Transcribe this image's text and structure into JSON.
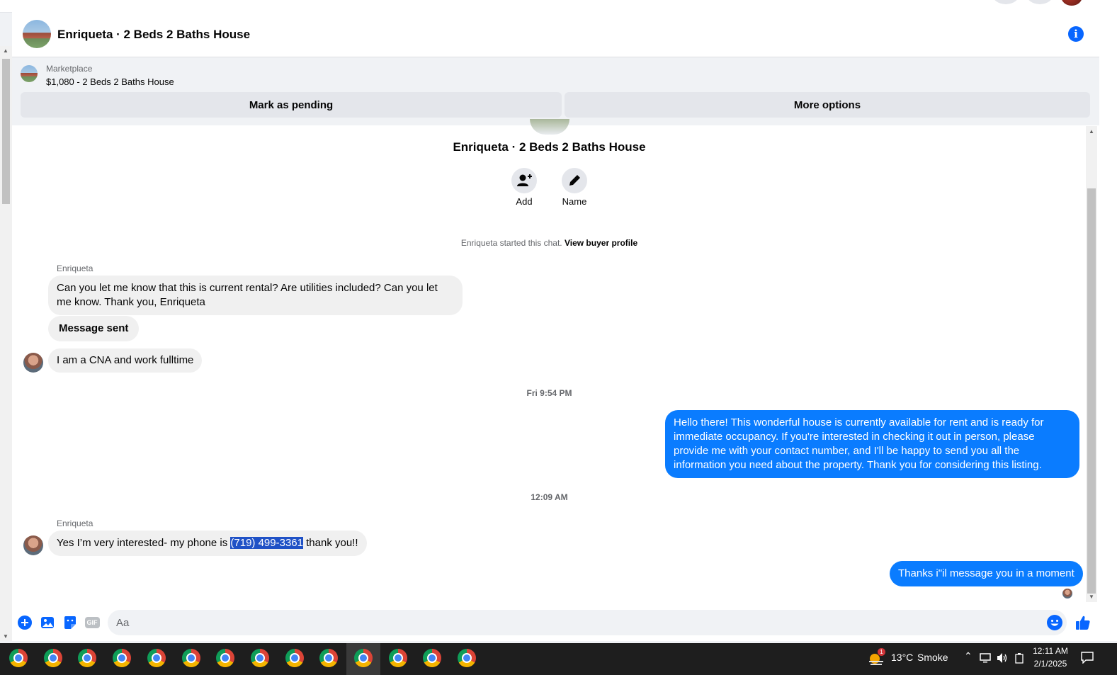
{
  "header": {
    "title": "Enriqueta · 2 Beds 2 Baths House"
  },
  "marketplace": {
    "label": "Marketplace",
    "listing": "$1,080 - 2 Beds 2 Baths House",
    "mark_pending": "Mark as pending",
    "more_options": "More options"
  },
  "conversation": {
    "title": "Enriqueta · 2 Beds 2 Baths House",
    "add_label": "Add",
    "name_label": "Name",
    "started_text": "Enriqueta started this chat.",
    "view_profile": "View buyer profile"
  },
  "messages": {
    "sender1": "Enriqueta",
    "msg1": "Can you let me know that this is current rental? Are utilities included? Can you let me know. Thank you, Enriqueta",
    "msg2": "Message sent",
    "msg3": "I am a CNA and work fulltime",
    "time1": "Fri 9:54 PM",
    "reply1": "Hello there! This wonderful house is currently available for rent and is ready for immediate occupancy. If you're interested in checking it out in person, please provide me with your contact number, and I'll be happy to send you all the information you need about the property. Thank you for considering this listing.",
    "time2": "12:09 AM",
    "sender2": "Enriqueta",
    "msg4_pre": "Yes I’m very interested- my phone is ",
    "msg4_phone": "(719) 499-3361",
    "msg4_post": " thank you!!",
    "reply2": "Thanks i\"il message you in a moment"
  },
  "composer": {
    "placeholder": "Aa",
    "gif_label": "GIF"
  },
  "taskbar": {
    "weather_temp": "13°C",
    "weather_desc": "Smoke",
    "weather_badge": "1",
    "time": "12:11 AM",
    "date": "2/1/2025"
  },
  "colors": {
    "accent": "#0866ff",
    "outgoing_bubble": "#0a7cff",
    "incoming_bubble": "#f0f0f0",
    "selection": "#1f51c6"
  },
  "icons": [
    "info-icon",
    "add-person-icon",
    "pencil-icon",
    "plus-icon",
    "image-icon",
    "sticker-icon",
    "gif-icon",
    "emoji-icon",
    "thumbs-up-icon",
    "chrome-icon",
    "weather-icon",
    "chevron-up-icon",
    "network-icon",
    "volume-icon",
    "notification-icon"
  ]
}
